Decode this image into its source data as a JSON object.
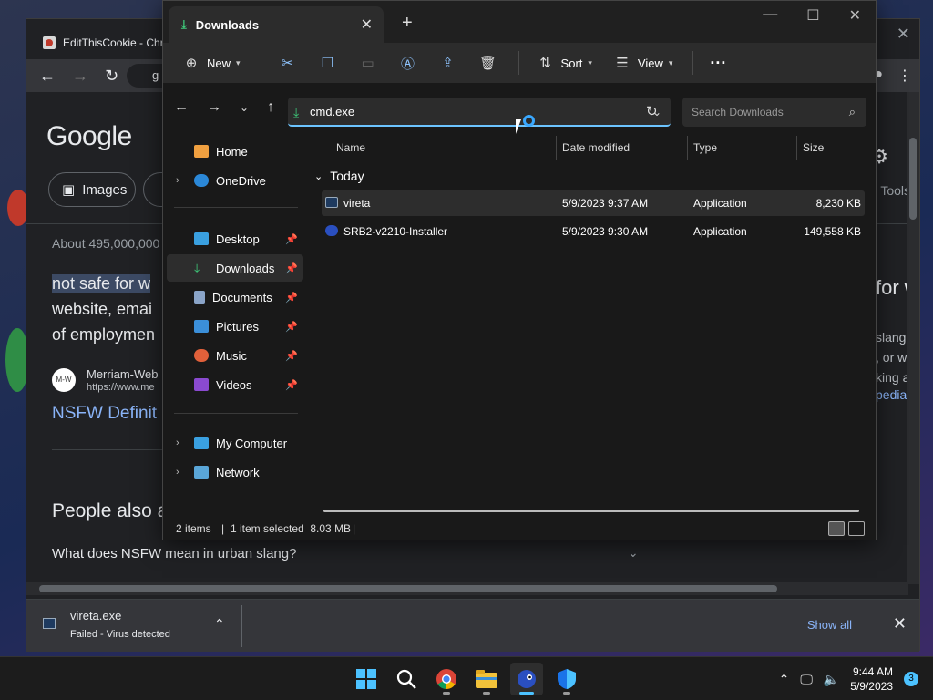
{
  "chrome": {
    "tab_title": "EditThisCookie - Chr",
    "omnibox_text": "g",
    "google": {
      "logo": "Google",
      "chip_images": "Images",
      "tools": "Tools",
      "about": "About 495,000,000",
      "snippet": [
        "not safe for w",
        "website, emai",
        "of employmen"
      ],
      "site_name": "Merriam-Web",
      "site_url": "https://www.me",
      "result_link": "NSFW Definit",
      "people_also": "People also a",
      "question": "What does NSFW mean in urban slang?",
      "right_heading": "for w",
      "right_lines": [
        "slang o",
        ", or we",
        "king at"
      ],
      "right_link": "pedia"
    },
    "download": {
      "file_name": "vireta.exe",
      "status": "Failed - Virus detected",
      "show_all": "Show all"
    }
  },
  "explorer": {
    "tab_title": "Downloads",
    "toolbar": {
      "new_label": "New",
      "sort_label": "Sort",
      "view_label": "View",
      "more_label": "···"
    },
    "address": "cmd.exe",
    "search_placeholder": "Search Downloads",
    "nav": {
      "home": "Home",
      "onedrive": "OneDrive",
      "desktop": "Desktop",
      "downloads": "Downloads",
      "documents": "Documents",
      "pictures": "Pictures",
      "music": "Music",
      "videos": "Videos",
      "my_computer": "My Computer",
      "network": "Network"
    },
    "columns": {
      "name": "Name",
      "date": "Date modified",
      "type": "Type",
      "size": "Size"
    },
    "group_label": "Today",
    "files": [
      {
        "name": "vireta",
        "date": "5/9/2023 9:37 AM",
        "type": "Application",
        "size": "8,230 KB"
      },
      {
        "name": "SRB2-v2210-Installer",
        "date": "5/9/2023 9:30 AM",
        "type": "Application",
        "size": "149,558 KB"
      }
    ],
    "status": {
      "items": "2 items",
      "selected": "1 item selected  8.03 MB"
    }
  },
  "taskbar": {
    "time": "9:44 AM",
    "date": "5/9/2023",
    "notifications": "3"
  },
  "colors": {
    "accent": "#4cc2ff",
    "explorer_bg": "#191919",
    "toolbar_bg": "#2c2c2c",
    "link": "#8ab4f8"
  }
}
